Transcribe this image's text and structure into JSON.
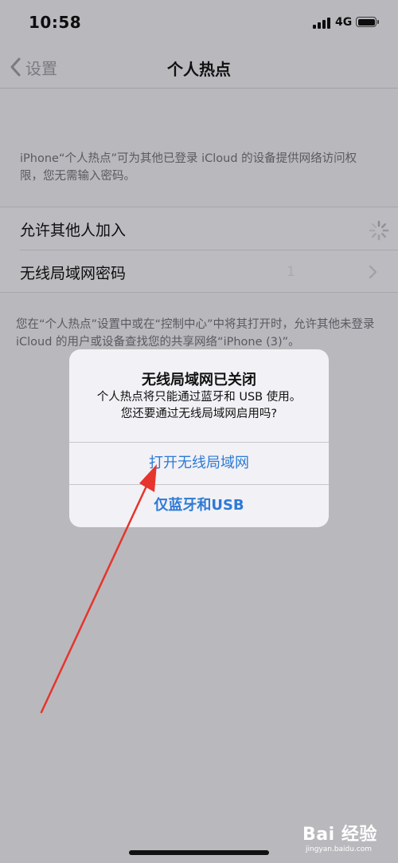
{
  "status_bar": {
    "time": "10:58",
    "network": "4G",
    "icons": [
      "signal-icon",
      "battery-icon"
    ]
  },
  "nav": {
    "back_label": "设置",
    "title": "个人热点"
  },
  "description": "iPhone“个人热点”可为其他已登录 iCloud 的设备提供网络访问权限，您无需输入密码。",
  "settings": {
    "rows": [
      {
        "label": "允许其他人加入"
      },
      {
        "label": "无线局域网密码"
      }
    ],
    "wifi_password_value": "1"
  },
  "footer_note": "您在“个人热点”设置中或在“控制中心”中将其打开时，允许其他未登录 iCloud 的用户或设备查找您的共享网络“iPhone (3)”。",
  "alert": {
    "title": "无线局域网已关闭",
    "message_line1": "个人热点将只能通过蓝牙和 USB 使用。",
    "message_line2": "您还要通过无线局域网启用吗?",
    "button_primary": "打开无线局域网",
    "button_secondary": "仅蓝牙和USB"
  },
  "watermark": {
    "brand": "Bai 经验",
    "url": "jingyan.baidu.com"
  },
  "colors": {
    "accent": "#2d7ad6",
    "annotation_arrow": "#e5352c"
  }
}
